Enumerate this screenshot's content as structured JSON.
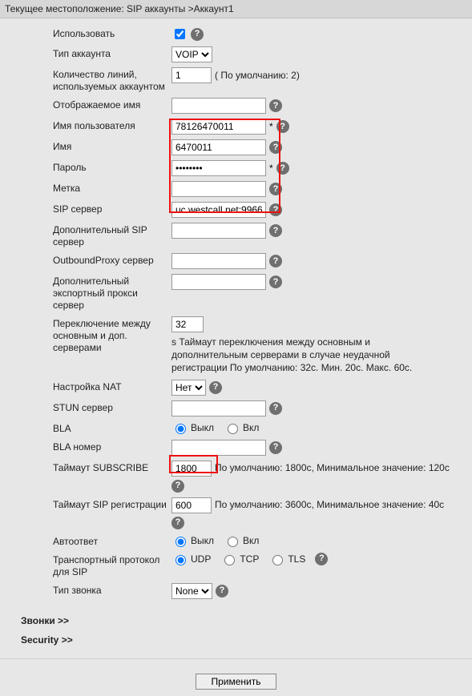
{
  "breadcrumb": "Текущее местоположение: SIP аккаунты >Аккаунт1",
  "labels": {
    "use": "Использовать",
    "acct_type": "Тип аккаунта",
    "lines": "Количество линий, используемых аккаунтом",
    "display_name": "Отображаемое имя",
    "username": "Имя пользователя",
    "name": "Имя",
    "password": "Пароль",
    "tag": "Метка",
    "sip_server": "SIP сервер",
    "add_sip": "Дополнительный SIP сервер",
    "outbound": "OutboundProxy сервер",
    "add_export": "Дополнительный экспортный прокси сервер",
    "switch": "Переключение между основным и доп. серверами",
    "nat": "Настройка NAT",
    "stun": "STUN сервер",
    "bla": "BLA",
    "bla_num": "BLA номер",
    "subscribe": "Таймаут SUBSCRIBE",
    "sip_reg": "Таймаут SIP регистрации",
    "autoanswer": "Автоответ",
    "transport": "Транспортный протокол для SIP",
    "ring_type": "Тип звонка"
  },
  "values": {
    "use_checked": true,
    "acct_type": "VOIP",
    "lines": "1",
    "lines_hint": "( По умолчанию: 2)",
    "display_name": "",
    "username": "78126470011",
    "name": "6470011",
    "password": "••••••••",
    "tag": "",
    "sip_server": "uc.westcall.net:9966",
    "add_sip": "",
    "outbound": "",
    "add_export": "",
    "switch": "32",
    "switch_hint": "s Таймаут переключения между основным и дополнительным серверами в случае неудачной регистрации По умолчанию: 32с. Мин. 20с. Макс. 60с.",
    "nat": "Нет",
    "stun": "",
    "off": "Выкл",
    "on": "Вкл",
    "bla_num": "",
    "subscribe": "1800",
    "subscribe_hint": "По умолчанию: 1800с, Минимальное значение: 120с",
    "sip_reg": "600",
    "sip_reg_hint": "По умолчанию: 3600с, Минимальное значение: 40с",
    "udp": "UDP",
    "tcp": "TCP",
    "tls": "TLS",
    "ring_type": "None"
  },
  "sections": {
    "calls": "Звонки   >>",
    "security": "Security   >>"
  },
  "apply": "Применить"
}
